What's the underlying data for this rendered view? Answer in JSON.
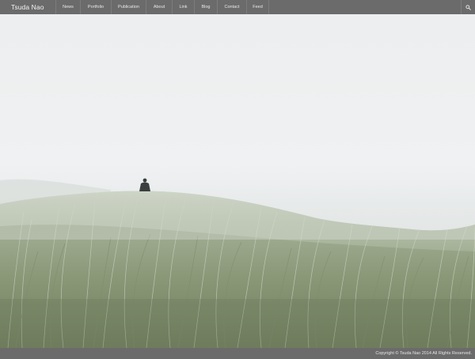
{
  "site": {
    "title": "Tsuda Nao"
  },
  "nav": {
    "items": [
      {
        "label": "News"
      },
      {
        "label": "Portfolio"
      },
      {
        "label": "Publication"
      },
      {
        "label": "About"
      },
      {
        "label": "Link"
      },
      {
        "label": "Blog"
      },
      {
        "label": "Contact"
      },
      {
        "label": "Feed"
      }
    ],
    "search_icon": "search-icon"
  },
  "hero": {
    "description_icon": "photo"
  },
  "footer": {
    "copyright": "Copyright © Tsuda Nao 2014 All Rights Reserved."
  },
  "colors": {
    "bar": "#6b6b6b",
    "text": "#e8e8e8"
  }
}
